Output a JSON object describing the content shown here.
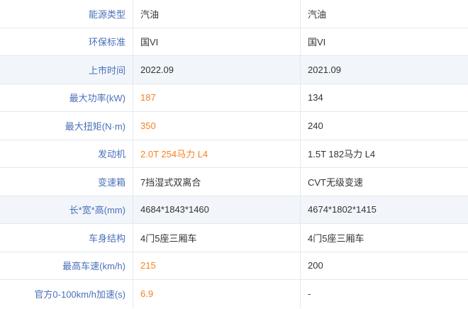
{
  "rows": [
    {
      "label": "能源类型",
      "a": "汽油",
      "b": "汽油",
      "hl": false
    },
    {
      "label": "环保标准",
      "a": "国VI",
      "b": "国VI",
      "hl": false
    },
    {
      "label": "上市时间",
      "a": "2022.09",
      "b": "2021.09",
      "hl": false
    },
    {
      "label": "最大功率(kW)",
      "a": "187",
      "b": "134",
      "hl": true
    },
    {
      "label": "最大扭矩(N·m)",
      "a": "350",
      "b": "240",
      "hl": true
    },
    {
      "label": "发动机",
      "a": "2.0T 254马力 L4",
      "b": "1.5T 182马力 L4",
      "hl": true
    },
    {
      "label": "变速箱",
      "a": "7挡湿式双离合",
      "b": "CVT无级变速",
      "hl": false
    },
    {
      "label": "长*宽*高(mm)",
      "a": "4684*1843*1460",
      "b": "4674*1802*1415",
      "hl": false
    },
    {
      "label": "车身结构",
      "a": "4门5座三厢车",
      "b": "4门5座三厢车",
      "hl": false
    },
    {
      "label": "最高车速(km/h)",
      "a": "215",
      "b": "200",
      "hl": true
    },
    {
      "label": "官方0-100km/h加速(s)",
      "a": "6.9",
      "b": "-",
      "hl": true
    }
  ],
  "colors": {
    "label": "#4a70b8",
    "highlight": "#f58220",
    "text": "#333333",
    "row_shade": "#f2f6fb",
    "border": "#e3e8f0"
  }
}
